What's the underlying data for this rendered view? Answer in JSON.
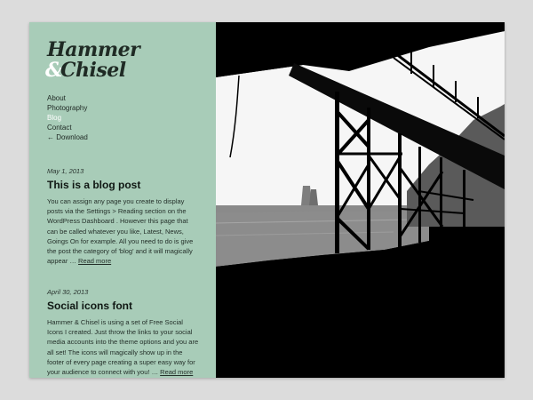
{
  "site": {
    "logo_line1": "Hammer",
    "logo_amp": "&",
    "logo_line2": "Chisel"
  },
  "nav": {
    "items": [
      {
        "label": "About"
      },
      {
        "label": "Photography"
      },
      {
        "label": "Blog",
        "active": true
      },
      {
        "label": "Contact"
      },
      {
        "label": "← Download"
      }
    ]
  },
  "posts": [
    {
      "date": "May 1, 2013",
      "title": "This is a blog post",
      "body": "You can assign any page you create to display posts via the Settings > Reading section on the WordPress Dashboard . However this page that can be called whatever you like, Latest, News, Goings On for example. All you need to do is give the post the category of 'blog' and it will magically appear … ",
      "read_more": "Read more"
    },
    {
      "date": "April 30, 2013",
      "title": "Social icons font",
      "body": "Hammer & Chisel is using a set of Free Social Icons I created. Just throw the links to your social media accounts into the theme options and you are all set! The icons will magically show up in the footer of every page creating a super easy way for your audience to connect with you! … ",
      "read_more": "Read more"
    }
  ],
  "colors": {
    "sidebar_bg": "#a8ccb8",
    "active_nav": "#ffffff",
    "page_bg": "#dcdcdc"
  }
}
